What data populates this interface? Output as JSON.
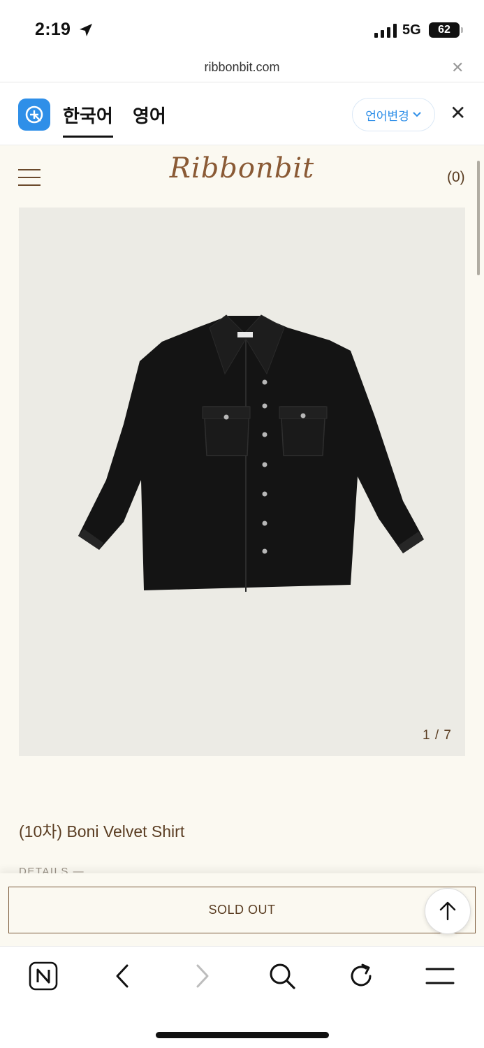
{
  "status_bar": {
    "time": "2:19",
    "network": "5G",
    "battery": "62"
  },
  "url_bar": {
    "domain": "ribbonbit.com"
  },
  "translate_bar": {
    "tab_korean": "한국어",
    "tab_english": "영어",
    "change_language": "언어변경",
    "accent_color": "#2f8fe8"
  },
  "site": {
    "brand": "Ribbonbit",
    "cart_count": "(0)",
    "image_counter": "1 / 7",
    "product_title": "(10차) Boni Velvet Shirt",
    "details_label": "DETAILS —",
    "sold_out_label": "SOLD OUT",
    "brand_color": "#8a5a35",
    "background_color": "#fbf9f1"
  },
  "toolbar": {
    "icons": [
      "naver-home-icon",
      "back-icon",
      "forward-icon",
      "search-icon",
      "refresh-icon",
      "menu-icon"
    ]
  }
}
